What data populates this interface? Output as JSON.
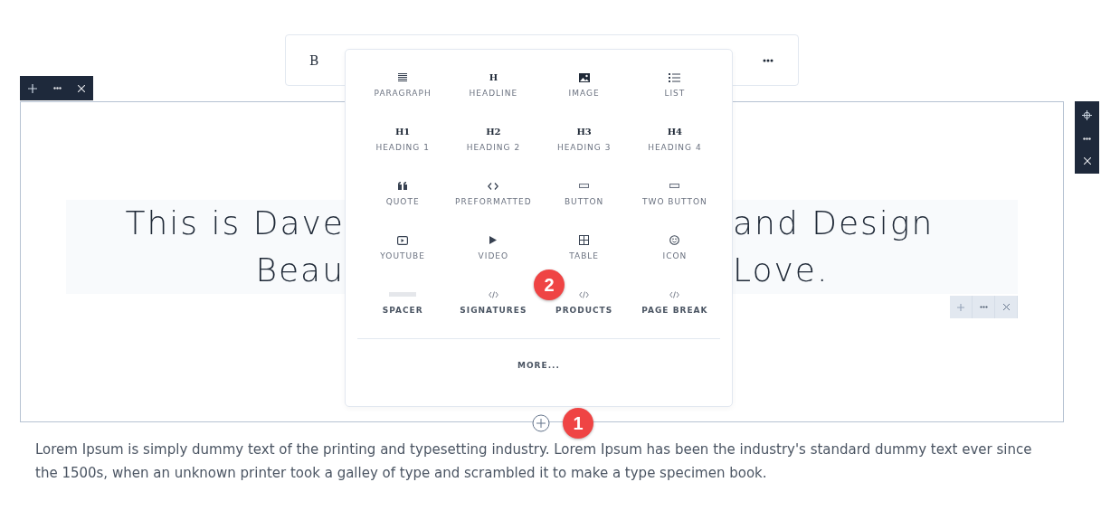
{
  "format_toolbar": {
    "bold_label": "B"
  },
  "block_tools": {
    "buttons": [
      {
        "kind": "add"
      },
      {
        "kind": "more"
      },
      {
        "kind": "close"
      }
    ]
  },
  "side_tools": {
    "buttons": [
      {
        "kind": "move"
      },
      {
        "kind": "more"
      },
      {
        "kind": "close"
      }
    ]
  },
  "heading": {
    "lines": [
      {
        "left": "This is Dave",
        "right": "and Design"
      },
      {
        "left": "Beau",
        "right": "Love."
      }
    ]
  },
  "inline_tools": {
    "buttons": [
      {
        "kind": "add"
      },
      {
        "kind": "more"
      },
      {
        "kind": "close"
      }
    ]
  },
  "insert_menu": {
    "rows": [
      {
        "items": [
          {
            "kind": "paragraph",
            "label": "PARAGRAPH",
            "bold": false
          },
          {
            "kind": "glyph",
            "glyph": "H",
            "label": "HEADLINE",
            "bold": false
          },
          {
            "kind": "image",
            "label": "IMAGE",
            "bold": false
          },
          {
            "kind": "list",
            "label": "LIST",
            "bold": false
          }
        ]
      },
      {
        "items": [
          {
            "kind": "glyph",
            "glyph": "H1",
            "label": "HEADING 1",
            "bold": false
          },
          {
            "kind": "glyph",
            "glyph": "H2",
            "label": "HEADING 2",
            "bold": false
          },
          {
            "kind": "glyph",
            "glyph": "H3",
            "label": "HEADING 3",
            "bold": false
          },
          {
            "kind": "glyph",
            "glyph": "H4",
            "label": "HEADING 4",
            "bold": false
          }
        ]
      },
      {
        "items": [
          {
            "kind": "quote",
            "label": "QUOTE",
            "bold": false
          },
          {
            "kind": "code",
            "label": "PREFORMATTED",
            "bold": false
          },
          {
            "kind": "button",
            "label": "BUTTON",
            "bold": false
          },
          {
            "kind": "button",
            "label": "TWO BUTTON",
            "bold": false
          }
        ]
      },
      {
        "items": [
          {
            "kind": "youtube",
            "label": "YOUTUBE",
            "bold": false
          },
          {
            "kind": "play",
            "label": "VIDEO",
            "bold": false
          },
          {
            "kind": "table",
            "label": "TABLE",
            "bold": false
          },
          {
            "kind": "smiley",
            "label": "ICON",
            "bold": false
          }
        ]
      },
      {
        "items": [
          {
            "kind": "spacer",
            "label": "SPACER",
            "bold": true
          },
          {
            "kind": "snippet",
            "label": "SIGNATURES",
            "bold": true
          },
          {
            "kind": "snippet",
            "label": "PRODUCTS",
            "bold": true
          },
          {
            "kind": "snippet",
            "label": "PAGE BREAK",
            "bold": true
          }
        ]
      }
    ],
    "more_label": "MORE..."
  },
  "step_badges": [
    {
      "number": "1"
    },
    {
      "number": "2"
    }
  ],
  "body_text": "Lorem Ipsum is simply dummy text of the printing and typesetting industry. Lorem Ipsum has been the industry's standard dummy text ever since the 1500s, when an unknown printer took a galley of type and scrambled it to make a type specimen book."
}
